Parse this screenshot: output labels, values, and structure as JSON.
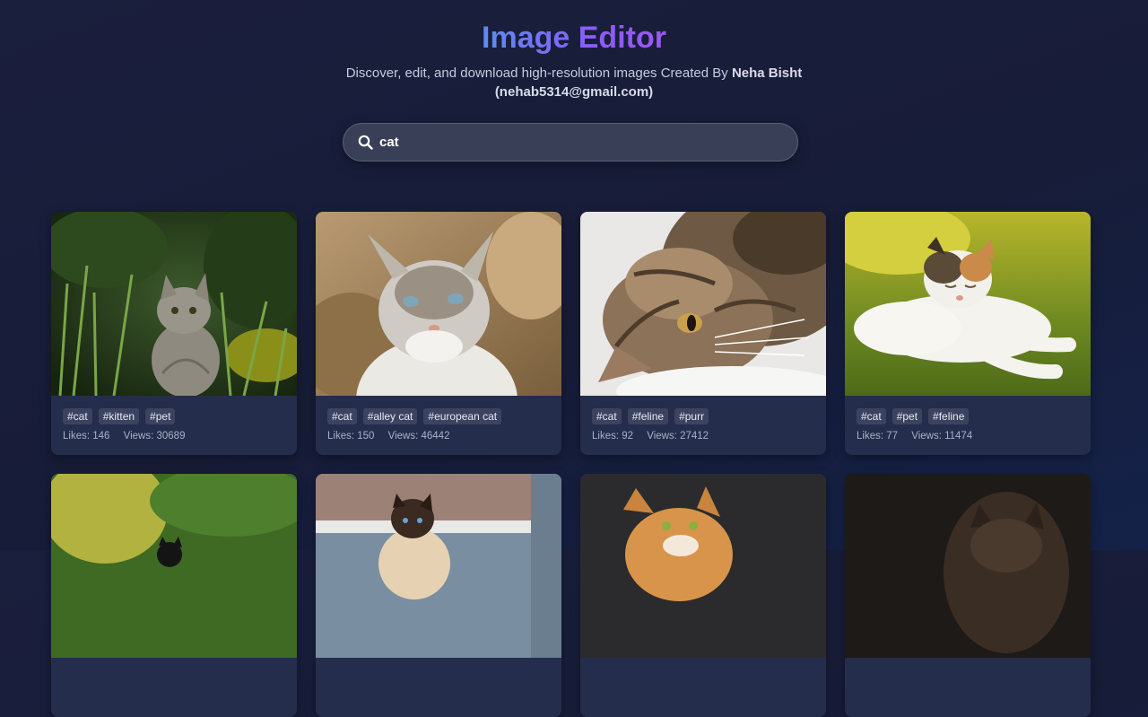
{
  "header": {
    "title": "Image Editor",
    "subtitle_prefix": "Discover, edit, and download high-resolution images Created By",
    "author_name": "Neha Bisht",
    "author_email": "(nehab5314@gmail.com)"
  },
  "search": {
    "value": "cat",
    "icon": "search-icon"
  },
  "cards": [
    {
      "tags": [
        "#cat",
        "#kitten",
        "#pet"
      ],
      "likes_label": "Likes: 146",
      "views_label": "Views: 30689"
    },
    {
      "tags": [
        "#cat",
        "#alley cat",
        "#european cat"
      ],
      "likes_label": "Likes: 150",
      "views_label": "Views: 46442"
    },
    {
      "tags": [
        "#cat",
        "#feline",
        "#purr"
      ],
      "likes_label": "Likes: 92",
      "views_label": "Views: 27412"
    },
    {
      "tags": [
        "#cat",
        "#pet",
        "#feline"
      ],
      "likes_label": "Likes: 77",
      "views_label": "Views: 11474"
    },
    {
      "tags": [],
      "likes_label": "",
      "views_label": ""
    },
    {
      "tags": [],
      "likes_label": "",
      "views_label": ""
    },
    {
      "tags": [],
      "likes_label": "",
      "views_label": ""
    },
    {
      "tags": [],
      "likes_label": "",
      "views_label": ""
    }
  ],
  "colors": {
    "title_start": "#5b8cf0",
    "title_end": "#9b57f0",
    "card_bg": "#252d4d",
    "tag_bg": "#3b4360"
  }
}
